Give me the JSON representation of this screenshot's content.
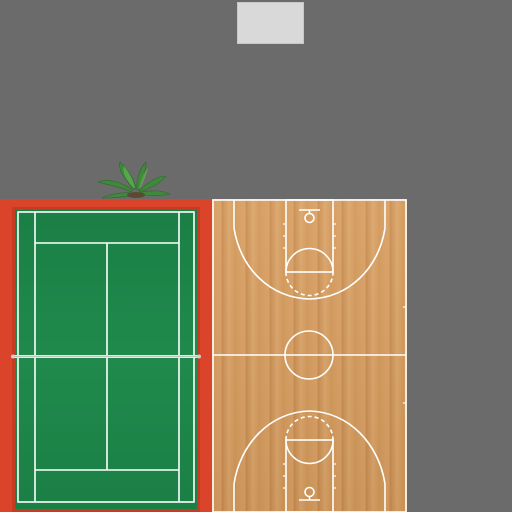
{
  "scene": {
    "background_color": "#6b6b6b",
    "objects": [
      {
        "name": "top-panel",
        "color": "#d9d9d9"
      },
      {
        "name": "potted-plant",
        "icon": "fern-plant-icon"
      },
      {
        "name": "tennis-court",
        "surface_color": "#1f8a4c",
        "surround_color": "#d9442a",
        "line_color": "#ffffff"
      },
      {
        "name": "basketball-court",
        "surface_color": "#d49a5b",
        "line_color": "#ffffff"
      }
    ]
  }
}
